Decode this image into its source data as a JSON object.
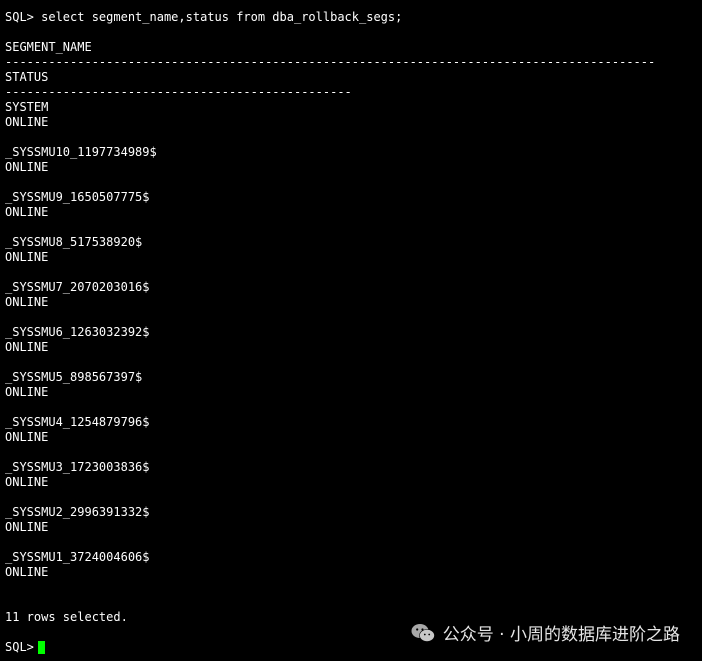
{
  "terminal": {
    "command_line": "SQL> select segment_name,status from dba_rollback_segs;",
    "blank_after_command": "",
    "col_segment_name": "SEGMENT_NAME",
    "col_segment_name_rule": "------------------------------------------------------------------------------------------",
    "col_status": "STATUS",
    "col_status_rule": "------------------------------------------------",
    "rows": [
      {
        "segment_name": "SYSTEM",
        "status": "ONLINE"
      },
      {
        "segment_name": "_SYSSMU10_1197734989$",
        "status": "ONLINE"
      },
      {
        "segment_name": "_SYSSMU9_1650507775$",
        "status": "ONLINE"
      },
      {
        "segment_name": "_SYSSMU8_517538920$",
        "status": "ONLINE"
      },
      {
        "segment_name": "_SYSSMU7_2070203016$",
        "status": "ONLINE"
      },
      {
        "segment_name": "_SYSSMU6_1263032392$",
        "status": "ONLINE"
      },
      {
        "segment_name": "_SYSSMU5_898567397$",
        "status": "ONLINE"
      },
      {
        "segment_name": "_SYSSMU4_1254879796$",
        "status": "ONLINE"
      },
      {
        "segment_name": "_SYSSMU3_1723003836$",
        "status": "ONLINE"
      },
      {
        "segment_name": "_SYSSMU2_2996391332$",
        "status": "ONLINE"
      },
      {
        "segment_name": "_SYSSMU1_3724004606$",
        "status": "ONLINE"
      }
    ],
    "footer": "11 rows selected.",
    "prompt": "SQL>",
    "cursor_color": "#00ff00"
  },
  "watermark": {
    "text": "公众号 · 小周的数据库进阶之路",
    "icon": "wechat-icon"
  }
}
